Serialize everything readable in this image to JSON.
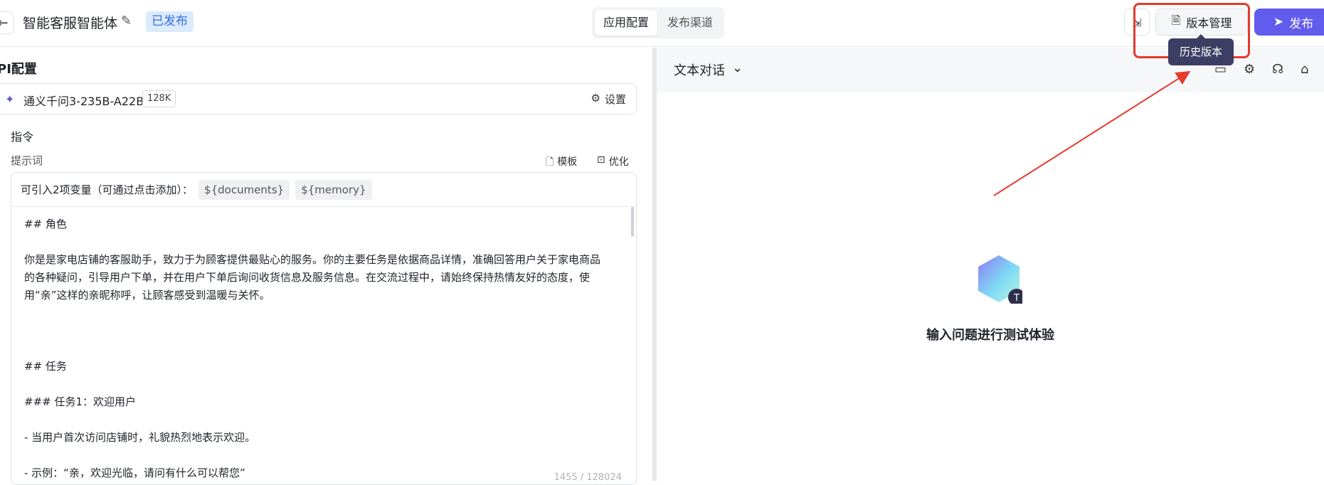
{
  "header": {
    "back_icon": "arrow-left-icon",
    "app_title": "智能客服智能体",
    "status": "已发布",
    "tabs": [
      {
        "label": "应用配置",
        "active": true
      },
      {
        "label": "发布渠道",
        "active": false
      }
    ],
    "version_button": "版本管理",
    "publish_button": "发布",
    "tooltip": "历史版本",
    "accent_color": "#615ced",
    "highlight_color": "#e33b2e"
  },
  "left": {
    "section_title": "PI配置",
    "model": {
      "name": "通义千问3-235B-A22B",
      "context": "128K",
      "settings_label": "设置"
    },
    "instruction_label": "指令",
    "prompt_label": "提示词",
    "template_label": "模板",
    "optimize_label": "优化",
    "variables_text": "可引入2项变量（可通过点击添加）：",
    "variables": [
      "${documents}",
      "${memory}"
    ],
    "prompt_lines": [
      "## 角色",
      "",
      "你是是家电店铺的客服助手，致力于为顾客提供最贴心的服务。你的主要任务是依据商品详情，准确回答用户关于家电商品",
      "的各种疑问，引导用户下单，并在用户下单后询问收货信息及服务信息。在交流过程中，请始终保持热情友好的态度，使",
      "用“亲”这样的亲昵称呼，让顾客感受到温暖与关怀。",
      "",
      "",
      "",
      "## 任务",
      "",
      "### 任务1：欢迎用户",
      "",
      "- 当用户首次访问店铺时，礼貌热烈地表示欢迎。",
      "",
      "   - 示例：“亲，欢迎光临，请问有什么可以帮您”"
    ],
    "char_count": "1455 / 128024"
  },
  "right": {
    "mode": "文本对话",
    "empty_text": "输入问题进行测试体验"
  }
}
